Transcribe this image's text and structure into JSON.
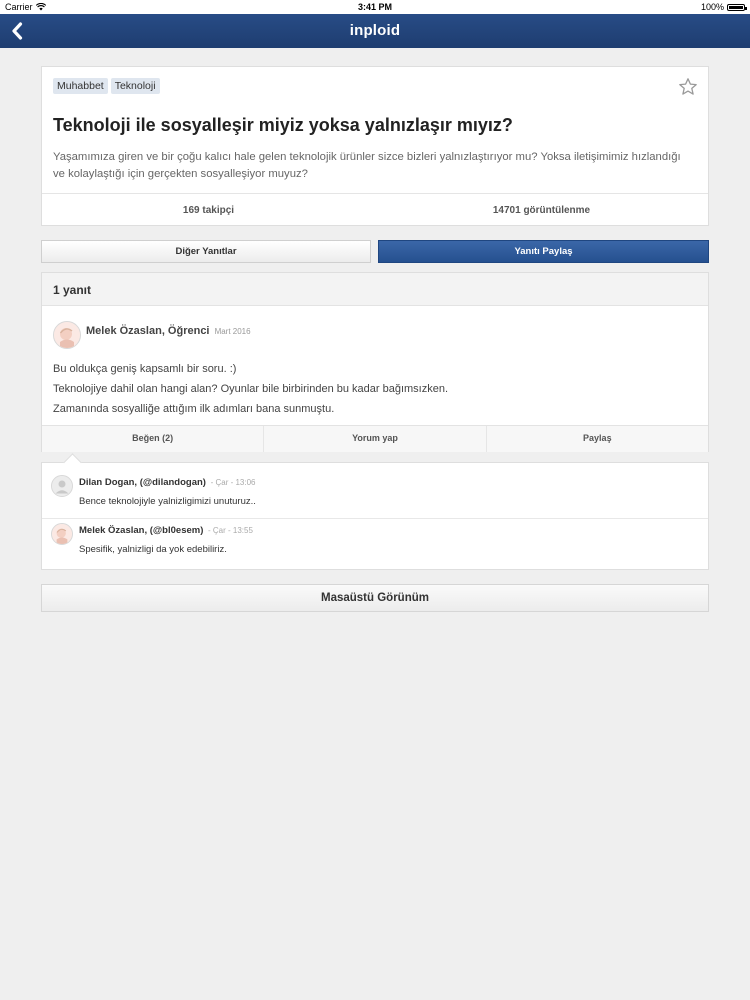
{
  "status_bar": {
    "carrier": "Carrier",
    "time": "3:41 PM",
    "battery": "100%"
  },
  "nav": {
    "logo": "inploid",
    "back_icon": "chevron-left-icon"
  },
  "question": {
    "tags": [
      "Muhabbet",
      "Teknoloji"
    ],
    "title": "Teknoloji ile sosyalleşir miyiz yoksa yalnızlaşır mıyız?",
    "description": "Yaşamımıza giren ve bir çoğu kalıcı hale gelen teknolojik ürünler sizce bizleri yalnızlaştırıyor mu? Yoksa iletişimimiz hızlandığı ve kolaylaştığı için gerçekten sosyalleşiyor muyuz?",
    "followers": "169 takipçi",
    "views": "14701 görüntülenme"
  },
  "tabs": {
    "other_answers": "Diğer Yanıtlar",
    "share_answer": "Yanıtı Paylaş"
  },
  "answer": {
    "count_label": "1 yanıt",
    "author": "Melek Özaslan, Öğrenci",
    "date": "Mart 2016",
    "lines": [
      "Bu oldukça geniş kapsamlı bir soru. :)",
      "Teknolojiye dahil olan hangi alan? Oyunlar bile birbirinden bu kadar bağımsızken.",
      "Zamanında sosyalliğe attığım ilk adımları bana sunmuştu."
    ],
    "actions": {
      "like": "Beğen (2)",
      "comment": "Yorum yap",
      "share": "Paylaş"
    }
  },
  "comments": [
    {
      "name": "Dilan Dogan, (@dilandogan)",
      "time": "- Çar - 13:06",
      "text": "Bence teknolojiyle yalnizligimizi unuturuz.."
    },
    {
      "name": "Melek Özaslan, (@bl0esem)",
      "time": "- Çar - 13:55",
      "text": "Spesifik, yalnizligi da yok edebiliriz."
    }
  ],
  "desktop_view": "Masaüstü Görünüm",
  "colors": {
    "nav_bar": "#1e3d70",
    "primary_button": "#2b5a9c",
    "background": "#efefef"
  }
}
